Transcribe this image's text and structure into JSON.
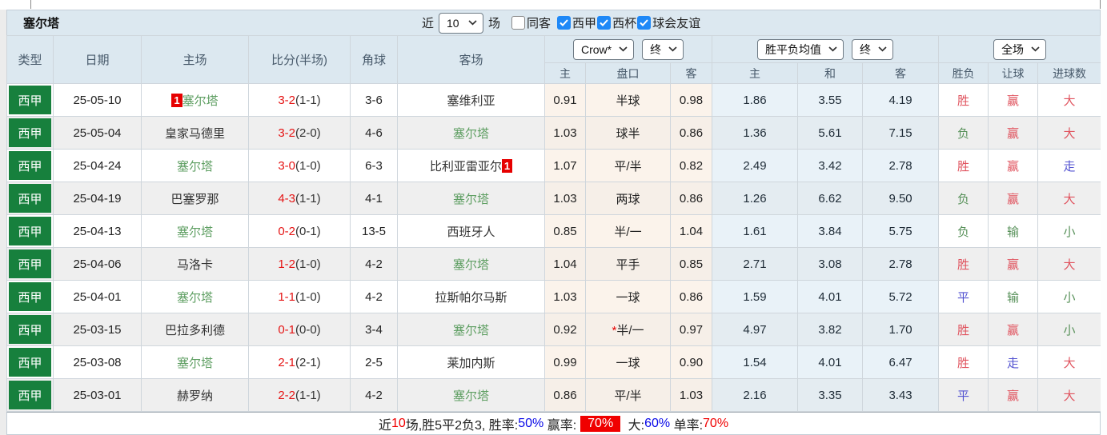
{
  "colors": {
    "header_bg": "#dce8f0",
    "league_green": "#17803d",
    "team_green": "#5f9f63",
    "score_red": "#e51414",
    "badge_red": "#e60000",
    "result_red": "#e0535e",
    "result_green": "#58915a",
    "result_blue": "#5353d1",
    "checkbox_blue": "#1e88f7",
    "handicap_col_bg": "#fbf3eb",
    "odds_col_bg": "#e9f2f8",
    "summary_blue": "#0808e8",
    "summary_red": "#f00000"
  },
  "icons": {
    "chevron_down": "∨",
    "checkbox_check": "✓"
  },
  "toolbar": {
    "team_title": "塞尔塔",
    "recent_prefix": "近",
    "recent_count": "10",
    "recent_suffix": "场",
    "same_venue": {
      "label": "同客",
      "checked": false
    },
    "league_filters": [
      {
        "label": "西甲",
        "checked": true
      },
      {
        "label": "西杯",
        "checked": true
      },
      {
        "label": "球会友谊",
        "checked": true
      }
    ]
  },
  "table": {
    "main_headers": [
      "类型",
      "日期",
      "主场",
      "比分(半场)",
      "角球",
      "客场"
    ],
    "groups": [
      {
        "selects": [
          "Crow*",
          "终"
        ],
        "subs": [
          "主",
          "盘口",
          "客"
        ]
      },
      {
        "selects": [
          "胜平负均值",
          "终"
        ],
        "subs": [
          "主",
          "和",
          "客"
        ]
      },
      {
        "selects": [
          "全场"
        ],
        "subs": [
          "胜负",
          "让球",
          "进球数"
        ]
      }
    ],
    "rows": [
      {
        "league": "西甲",
        "date": "25-05-10",
        "home": {
          "name": "塞尔塔",
          "self": true,
          "badge": "1",
          "badge_side": "left"
        },
        "score": "3-2",
        "half": "(1-1)",
        "corners": "3-6",
        "away": {
          "name": "塞维利亚",
          "self": false
        },
        "handicap": {
          "home": "0.91",
          "line": "半球",
          "away": "0.98",
          "star": false
        },
        "odds": {
          "home": "1.86",
          "draw": "3.55",
          "away": "4.19"
        },
        "results": [
          {
            "text": "胜",
            "color": "red"
          },
          {
            "text": "赢",
            "color": "red"
          },
          {
            "text": "大",
            "color": "red"
          }
        ]
      },
      {
        "league": "西甲",
        "date": "25-05-04",
        "home": {
          "name": "皇家马德里",
          "self": false
        },
        "score": "3-2",
        "half": "(2-0)",
        "corners": "4-6",
        "away": {
          "name": "塞尔塔",
          "self": true
        },
        "handicap": {
          "home": "1.03",
          "line": "球半",
          "away": "0.86",
          "star": false
        },
        "odds": {
          "home": "1.36",
          "draw": "5.61",
          "away": "7.15"
        },
        "results": [
          {
            "text": "负",
            "color": "green"
          },
          {
            "text": "赢",
            "color": "red"
          },
          {
            "text": "大",
            "color": "red"
          }
        ]
      },
      {
        "league": "西甲",
        "date": "25-04-24",
        "home": {
          "name": "塞尔塔",
          "self": true
        },
        "score": "3-0",
        "half": "(1-0)",
        "corners": "6-3",
        "away": {
          "name": "比利亚雷亚尔",
          "self": false,
          "badge": "1",
          "badge_side": "right"
        },
        "handicap": {
          "home": "1.07",
          "line": "平/半",
          "away": "0.82",
          "star": false
        },
        "odds": {
          "home": "2.49",
          "draw": "3.42",
          "away": "2.78"
        },
        "results": [
          {
            "text": "胜",
            "color": "red"
          },
          {
            "text": "赢",
            "color": "red"
          },
          {
            "text": "走",
            "color": "blue"
          }
        ]
      },
      {
        "league": "西甲",
        "date": "25-04-19",
        "home": {
          "name": "巴塞罗那",
          "self": false
        },
        "score": "4-3",
        "half": "(1-1)",
        "corners": "4-1",
        "away": {
          "name": "塞尔塔",
          "self": true
        },
        "handicap": {
          "home": "1.03",
          "line": "两球",
          "away": "0.86",
          "star": false
        },
        "odds": {
          "home": "1.26",
          "draw": "6.62",
          "away": "9.50"
        },
        "results": [
          {
            "text": "负",
            "color": "green"
          },
          {
            "text": "赢",
            "color": "red"
          },
          {
            "text": "大",
            "color": "red"
          }
        ]
      },
      {
        "league": "西甲",
        "date": "25-04-13",
        "home": {
          "name": "塞尔塔",
          "self": true
        },
        "score": "0-2",
        "half": "(0-1)",
        "corners": "13-5",
        "away": {
          "name": "西班牙人",
          "self": false
        },
        "handicap": {
          "home": "0.85",
          "line": "半/一",
          "away": "1.04",
          "star": false
        },
        "odds": {
          "home": "1.61",
          "draw": "3.84",
          "away": "5.75"
        },
        "results": [
          {
            "text": "负",
            "color": "green"
          },
          {
            "text": "输",
            "color": "green"
          },
          {
            "text": "小",
            "color": "green"
          }
        ]
      },
      {
        "league": "西甲",
        "date": "25-04-06",
        "home": {
          "name": "马洛卡",
          "self": false
        },
        "score": "1-2",
        "half": "(1-0)",
        "corners": "4-2",
        "away": {
          "name": "塞尔塔",
          "self": true
        },
        "handicap": {
          "home": "1.04",
          "line": "平手",
          "away": "0.85",
          "star": false
        },
        "odds": {
          "home": "2.71",
          "draw": "3.08",
          "away": "2.78"
        },
        "results": [
          {
            "text": "胜",
            "color": "red"
          },
          {
            "text": "赢",
            "color": "red"
          },
          {
            "text": "大",
            "color": "red"
          }
        ]
      },
      {
        "league": "西甲",
        "date": "25-04-01",
        "home": {
          "name": "塞尔塔",
          "self": true
        },
        "score": "1-1",
        "half": "(1-0)",
        "corners": "4-2",
        "away": {
          "name": "拉斯帕尔马斯",
          "self": false
        },
        "handicap": {
          "home": "1.03",
          "line": "一球",
          "away": "0.86",
          "star": false
        },
        "odds": {
          "home": "1.59",
          "draw": "4.01",
          "away": "5.72"
        },
        "results": [
          {
            "text": "平",
            "color": "blue"
          },
          {
            "text": "输",
            "color": "green"
          },
          {
            "text": "小",
            "color": "green"
          }
        ]
      },
      {
        "league": "西甲",
        "date": "25-03-15",
        "home": {
          "name": "巴拉多利德",
          "self": false
        },
        "score": "0-1",
        "half": "(0-0)",
        "corners": "3-4",
        "away": {
          "name": "塞尔塔",
          "self": true
        },
        "handicap": {
          "home": "0.92",
          "line": "半/一",
          "away": "0.97",
          "star": true
        },
        "odds": {
          "home": "4.97",
          "draw": "3.82",
          "away": "1.70"
        },
        "results": [
          {
            "text": "胜",
            "color": "red"
          },
          {
            "text": "赢",
            "color": "red"
          },
          {
            "text": "小",
            "color": "green"
          }
        ]
      },
      {
        "league": "西甲",
        "date": "25-03-08",
        "home": {
          "name": "塞尔塔",
          "self": true
        },
        "score": "2-1",
        "half": "(2-1)",
        "corners": "2-5",
        "away": {
          "name": "莱加内斯",
          "self": false
        },
        "handicap": {
          "home": "0.99",
          "line": "一球",
          "away": "0.90",
          "star": false
        },
        "odds": {
          "home": "1.54",
          "draw": "4.01",
          "away": "6.47"
        },
        "results": [
          {
            "text": "胜",
            "color": "red"
          },
          {
            "text": "走",
            "color": "blue"
          },
          {
            "text": "大",
            "color": "red"
          }
        ]
      },
      {
        "league": "西甲",
        "date": "25-03-01",
        "home": {
          "name": "赫罗纳",
          "self": false
        },
        "score": "2-2",
        "half": "(1-1)",
        "corners": "4-2",
        "away": {
          "name": "塞尔塔",
          "self": true
        },
        "handicap": {
          "home": "0.86",
          "line": "平/半",
          "away": "1.03",
          "star": false
        },
        "odds": {
          "home": "2.16",
          "draw": "3.35",
          "away": "3.43"
        },
        "results": [
          {
            "text": "平",
            "color": "blue"
          },
          {
            "text": "赢",
            "color": "red"
          },
          {
            "text": "大",
            "color": "red"
          }
        ]
      }
    ]
  },
  "summary": {
    "segments": [
      {
        "text": "近",
        "style": "plain"
      },
      {
        "text": "10",
        "style": "red"
      },
      {
        "text": "场,胜5平2负3, 胜率:",
        "style": "plain"
      },
      {
        "text": "50%",
        "style": "blue"
      },
      {
        "text": " 赢率:",
        "style": "plain"
      },
      {
        "text": "70%",
        "style": "redbox"
      },
      {
        "text": " 大:",
        "style": "plain"
      },
      {
        "text": "60%",
        "style": "blue"
      },
      {
        "text": " 单率:",
        "style": "plain"
      },
      {
        "text": "70%",
        "style": "red"
      }
    ]
  }
}
